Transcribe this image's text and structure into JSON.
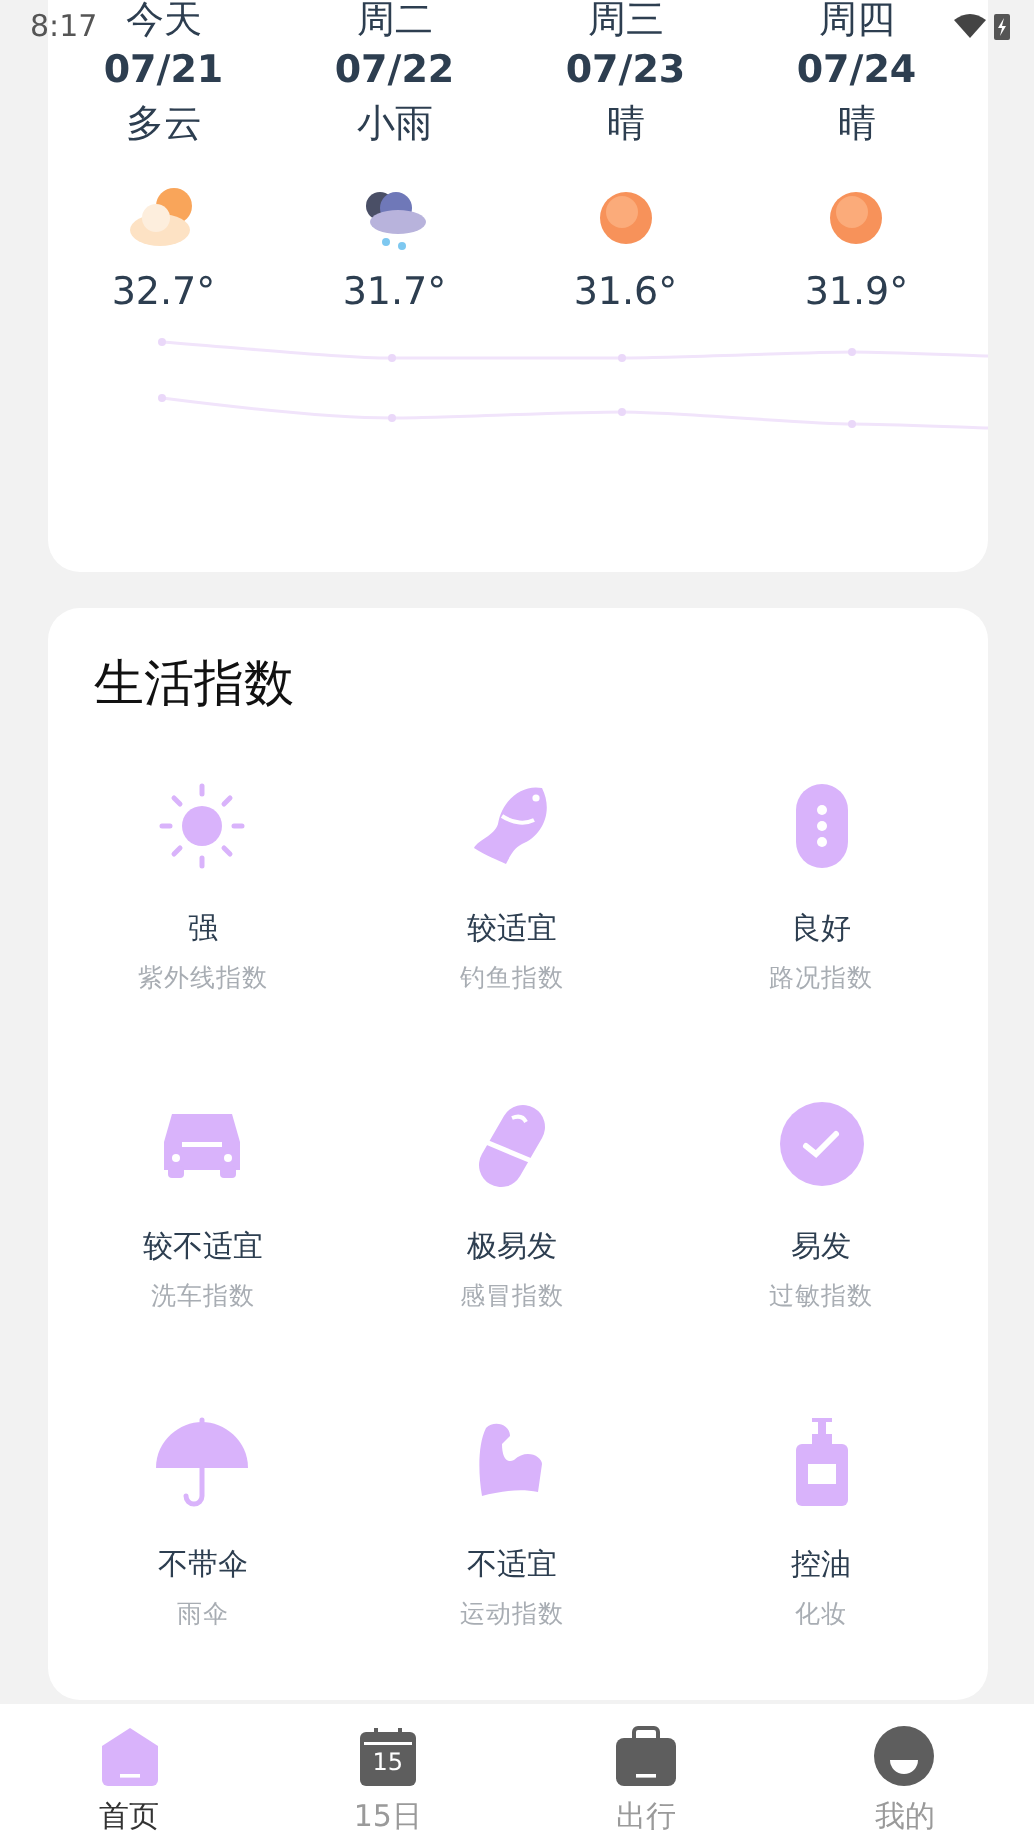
{
  "status_bar": {
    "time": "8:17"
  },
  "forecast": [
    {
      "day": "今天",
      "date": "07/21",
      "condition": "多云",
      "kind": "partly-cloudy",
      "high": "32.7°"
    },
    {
      "day": "周二",
      "date": "07/22",
      "condition": "小雨",
      "kind": "rain",
      "high": "31.7°"
    },
    {
      "day": "周三",
      "date": "07/23",
      "condition": "晴",
      "kind": "sunny",
      "high": "31.6°"
    },
    {
      "day": "周四",
      "date": "07/24",
      "condition": "晴",
      "kind": "sunny",
      "high": "31.9°"
    }
  ],
  "life_index": {
    "title": "生活指数",
    "items": [
      {
        "kind": "sun",
        "value": "强",
        "label": "紫外线指数"
      },
      {
        "kind": "fish",
        "value": "较适宜",
        "label": "钓鱼指数"
      },
      {
        "kind": "road",
        "value": "良好",
        "label": "路况指数"
      },
      {
        "kind": "car",
        "value": "较不适宜",
        "label": "洗车指数"
      },
      {
        "kind": "pill",
        "value": "极易发",
        "label": "感冒指数"
      },
      {
        "kind": "check",
        "value": "易发",
        "label": "过敏指数"
      },
      {
        "kind": "umbrella",
        "value": "不带伞",
        "label": "雨伞"
      },
      {
        "kind": "arm",
        "value": "不适宜",
        "label": "运动指数"
      },
      {
        "kind": "bottle",
        "value": "控油",
        "label": "化妆"
      }
    ]
  },
  "bottom_nav": [
    {
      "label": "首页",
      "kind": "home",
      "selected": true
    },
    {
      "label": "15日",
      "kind": "calendar",
      "icon_text": "15",
      "selected": false
    },
    {
      "label": "出行",
      "kind": "bag",
      "selected": false
    },
    {
      "label": "我的",
      "kind": "face",
      "selected": false
    }
  ]
}
